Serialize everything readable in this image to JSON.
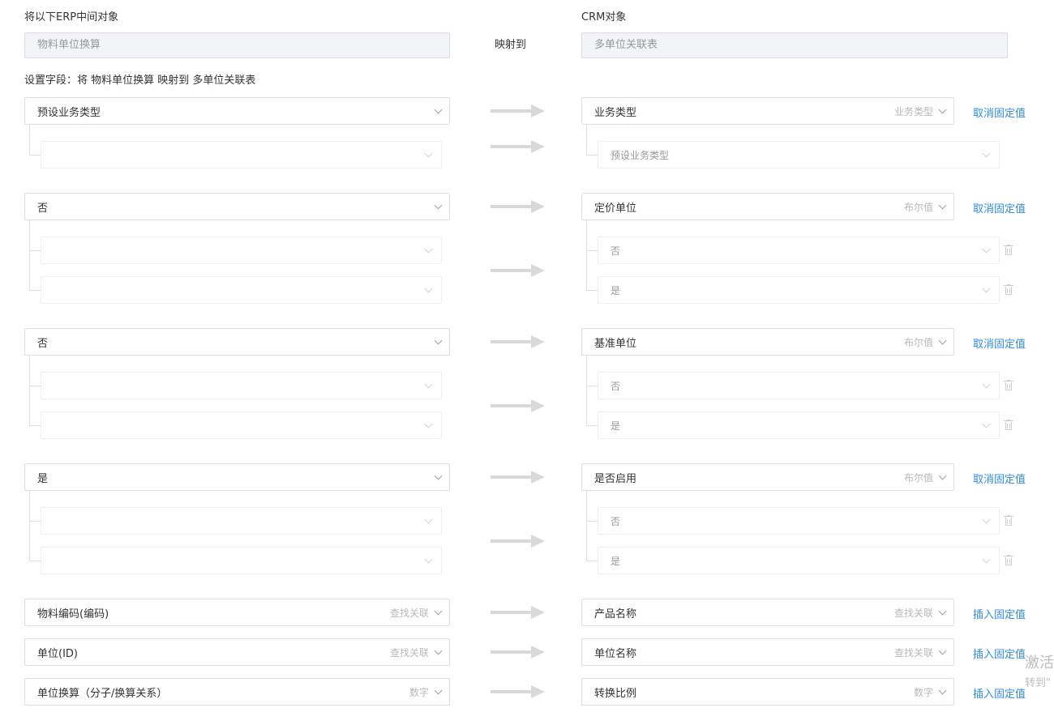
{
  "header": {
    "erp_label": "将以下ERP中间对象",
    "crm_label": "CRM对象",
    "erp_object": "物料单位换算",
    "map_to": "映射到",
    "crm_object": "多单位关联表",
    "field_setting": "设置字段：将 物料单位换算 映射到 多单位关联表"
  },
  "rows": [
    {
      "left": "预设业务类型",
      "right": "业务类型",
      "right_type": "业务类型",
      "action": "取消固定值",
      "left_subs": [
        ""
      ],
      "right_subs": [
        "预设业务类型"
      ]
    },
    {
      "left": "否",
      "right": "定价单位",
      "right_type": "布尔值",
      "action": "取消固定值",
      "left_subs": [
        "",
        ""
      ],
      "right_subs": [
        "否",
        "是"
      ]
    },
    {
      "left": "否",
      "right": "基准单位",
      "right_type": "布尔值",
      "action": "取消固定值",
      "left_subs": [
        "",
        ""
      ],
      "right_subs": [
        "否",
        "是"
      ]
    },
    {
      "left": "是",
      "right": "是否启用",
      "right_type": "布尔值",
      "action": "取消固定值",
      "left_subs": [
        "",
        ""
      ],
      "right_subs": [
        "否",
        "是"
      ]
    }
  ],
  "simple_rows": [
    {
      "left": "物料编码(编码)",
      "left_type": "查找关联",
      "right": "产品名称",
      "right_type": "查找关联",
      "action": "插入固定值"
    },
    {
      "left": "单位(ID)",
      "left_type": "查找关联",
      "right": "单位名称",
      "right_type": "查找关联",
      "action": "插入固定值"
    },
    {
      "left": "单位换算（分子/换算关系）",
      "left_type": "数字",
      "right": "转换比例",
      "right_type": "数字",
      "action": "插入固定值"
    }
  ],
  "watermark": {
    "line1": "激活",
    "line2": "转到\""
  },
  "icons": {
    "chevron": "chevron-down-icon",
    "arrow": "arrow-right-icon",
    "trash": "trash-icon"
  },
  "colors": {
    "link": "#2d8cf0",
    "border": "#dcdfe6",
    "readonly_bg": "#f2f4f7"
  }
}
